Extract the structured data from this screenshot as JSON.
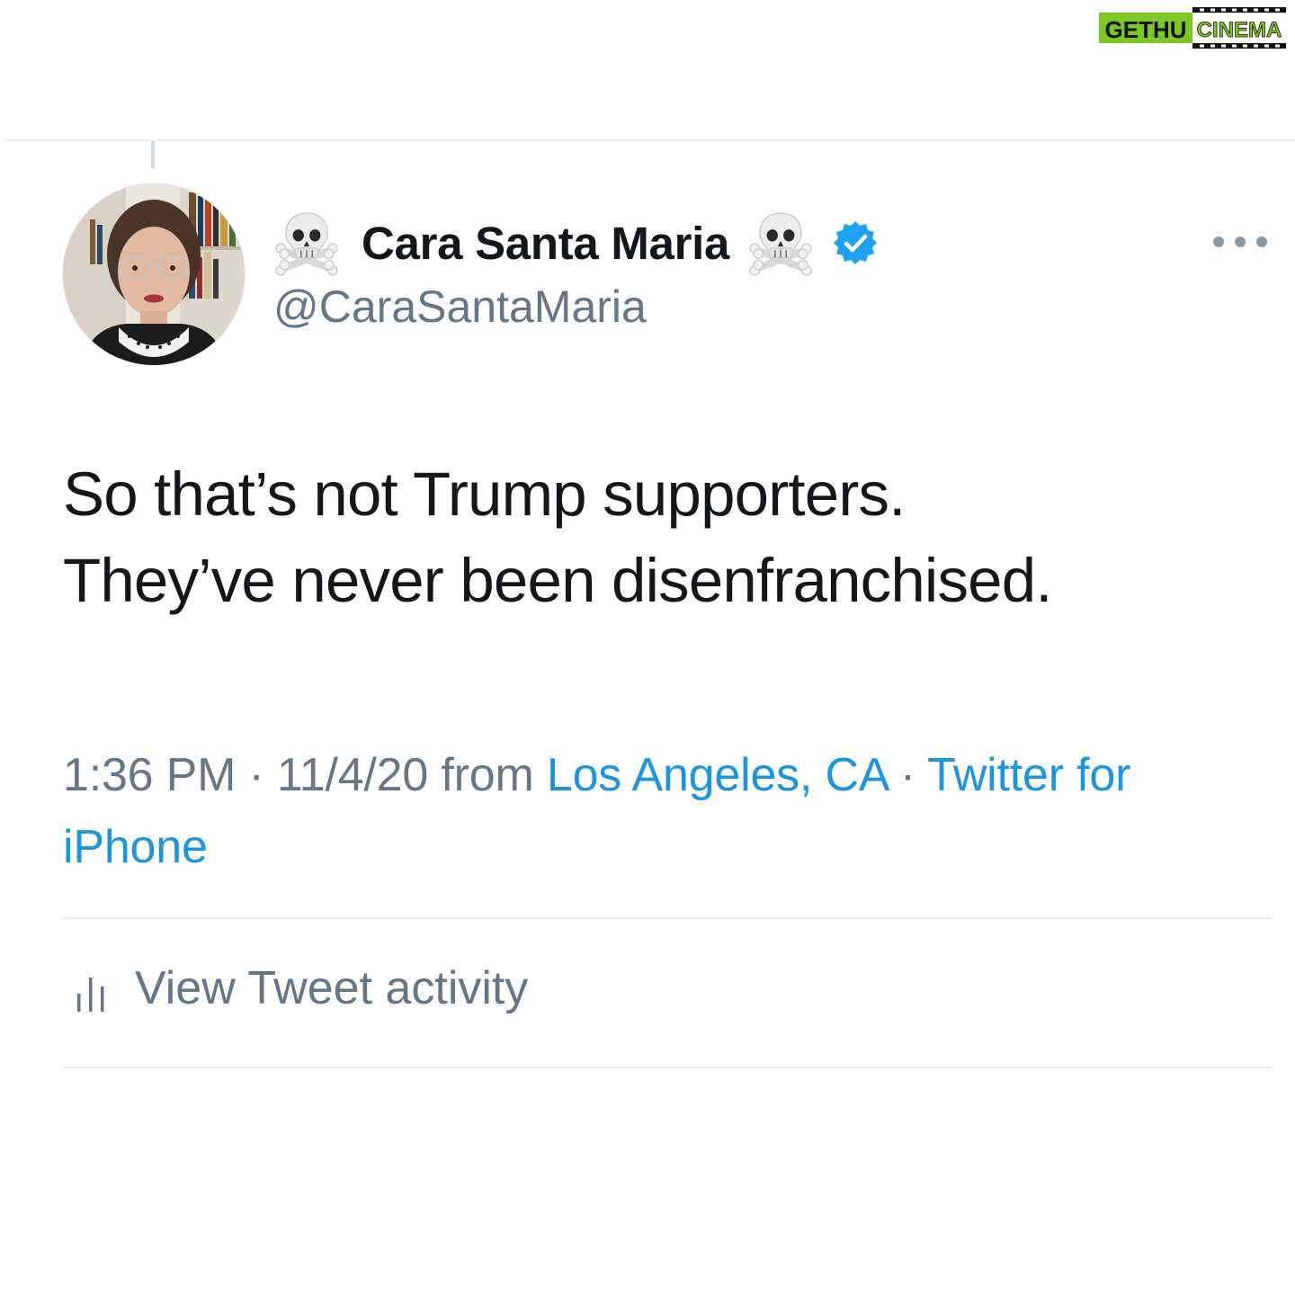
{
  "watermark": {
    "text_left": "GETHU",
    "text_right": "CINEMA",
    "bg": "#7dc623",
    "ink": "#111111"
  },
  "tweet": {
    "avatar_icon": "profile-photo",
    "name_prefix_emoji": "☠️",
    "display_name": "Cara Santa Maria",
    "name_suffix_emoji": "☠️",
    "verified_icon": "verified-badge-icon",
    "handle": "@CaraSantaMaria",
    "more_icon": "ellipsis-icon",
    "text_lines": [
      "So that’s not Trump supporters.",
      "They’ve never been disenfranchised."
    ],
    "time": "1:36 PM",
    "separator": " · ",
    "date": "11/4/20",
    "from_word": " from ",
    "location": "Los Angeles, CA",
    "source": "Twitter for iPhone",
    "activity_label": "View Tweet activity",
    "activity_icon": "bar-chart-icon"
  },
  "colors": {
    "text_primary": "#14171a",
    "text_secondary": "#657786",
    "link": "#1b95e0",
    "divider": "#e6ecf0",
    "verified": "#1da1f2"
  }
}
